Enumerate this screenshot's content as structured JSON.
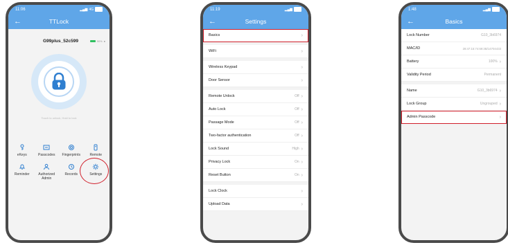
{
  "phone1": {
    "status": {
      "time": "11:06",
      "right": "4G"
    },
    "title": "TTLock",
    "back": "←",
    "device_name": "G99plus_52c599",
    "battery": "90%",
    "hint": "Touch to unlock, Hold to lock",
    "menu": [
      {
        "label": "eKeys",
        "icon": "ekey-icon"
      },
      {
        "label": "Passcodes",
        "icon": "passcode-icon"
      },
      {
        "label": "Fingerprints",
        "icon": "fingerprint-icon"
      },
      {
        "label": "Remote",
        "icon": "remote-icon"
      },
      {
        "label": "Reminder",
        "icon": "bell-icon"
      },
      {
        "label": "Authorized\nAdmin",
        "icon": "admin-icon"
      },
      {
        "label": "Records",
        "icon": "records-icon"
      },
      {
        "label": "Settings",
        "icon": "gear-icon"
      }
    ],
    "accent": "#5fa6e8",
    "highlight": "#d01e2a"
  },
  "phone2": {
    "status": {
      "time": "11:19"
    },
    "title": "Settings",
    "back": "←",
    "groups": [
      [
        {
          "label": "Basics",
          "value": ""
        }
      ],
      [
        {
          "label": "WiFi",
          "value": ""
        }
      ],
      [
        {
          "label": "Wireless Keypad",
          "value": ""
        },
        {
          "label": "Door Sensor",
          "value": ""
        }
      ],
      [
        {
          "label": "Remote Unlock",
          "value": "Off"
        },
        {
          "label": "Auto Lock",
          "value": "Off"
        },
        {
          "label": "Passage Mode",
          "value": "Off"
        },
        {
          "label": "Two-factor authentication",
          "value": "Off"
        },
        {
          "label": "Lock Sound",
          "value": "High"
        },
        {
          "label": "Privacy Lock",
          "value": "On"
        },
        {
          "label": "Reset Button",
          "value": "On"
        }
      ],
      [
        {
          "label": "Lock Clock",
          "value": ""
        },
        {
          "label": "Upload Data",
          "value": ""
        }
      ]
    ]
  },
  "phone3": {
    "status": {
      "time": "1:48"
    },
    "title": "Basics",
    "back": "←",
    "groups": [
      [
        {
          "label": "Lock Number",
          "value": "G10_3b6974",
          "chev": false
        },
        {
          "label": "MAC/ID",
          "value": "28:47:15:74:69:3B/14704433",
          "chev": false
        },
        {
          "label": "Battery",
          "value": "100%",
          "chev": true
        },
        {
          "label": "Validity Period",
          "value": "Permanent",
          "chev": false
        }
      ],
      [
        {
          "label": "Name",
          "value": "G10_3b6974",
          "chev": true
        },
        {
          "label": "Lock Group",
          "value": "Ungrouped",
          "chev": true
        },
        {
          "label": "Admin Passcode",
          "value": "",
          "chev": true
        }
      ]
    ]
  }
}
